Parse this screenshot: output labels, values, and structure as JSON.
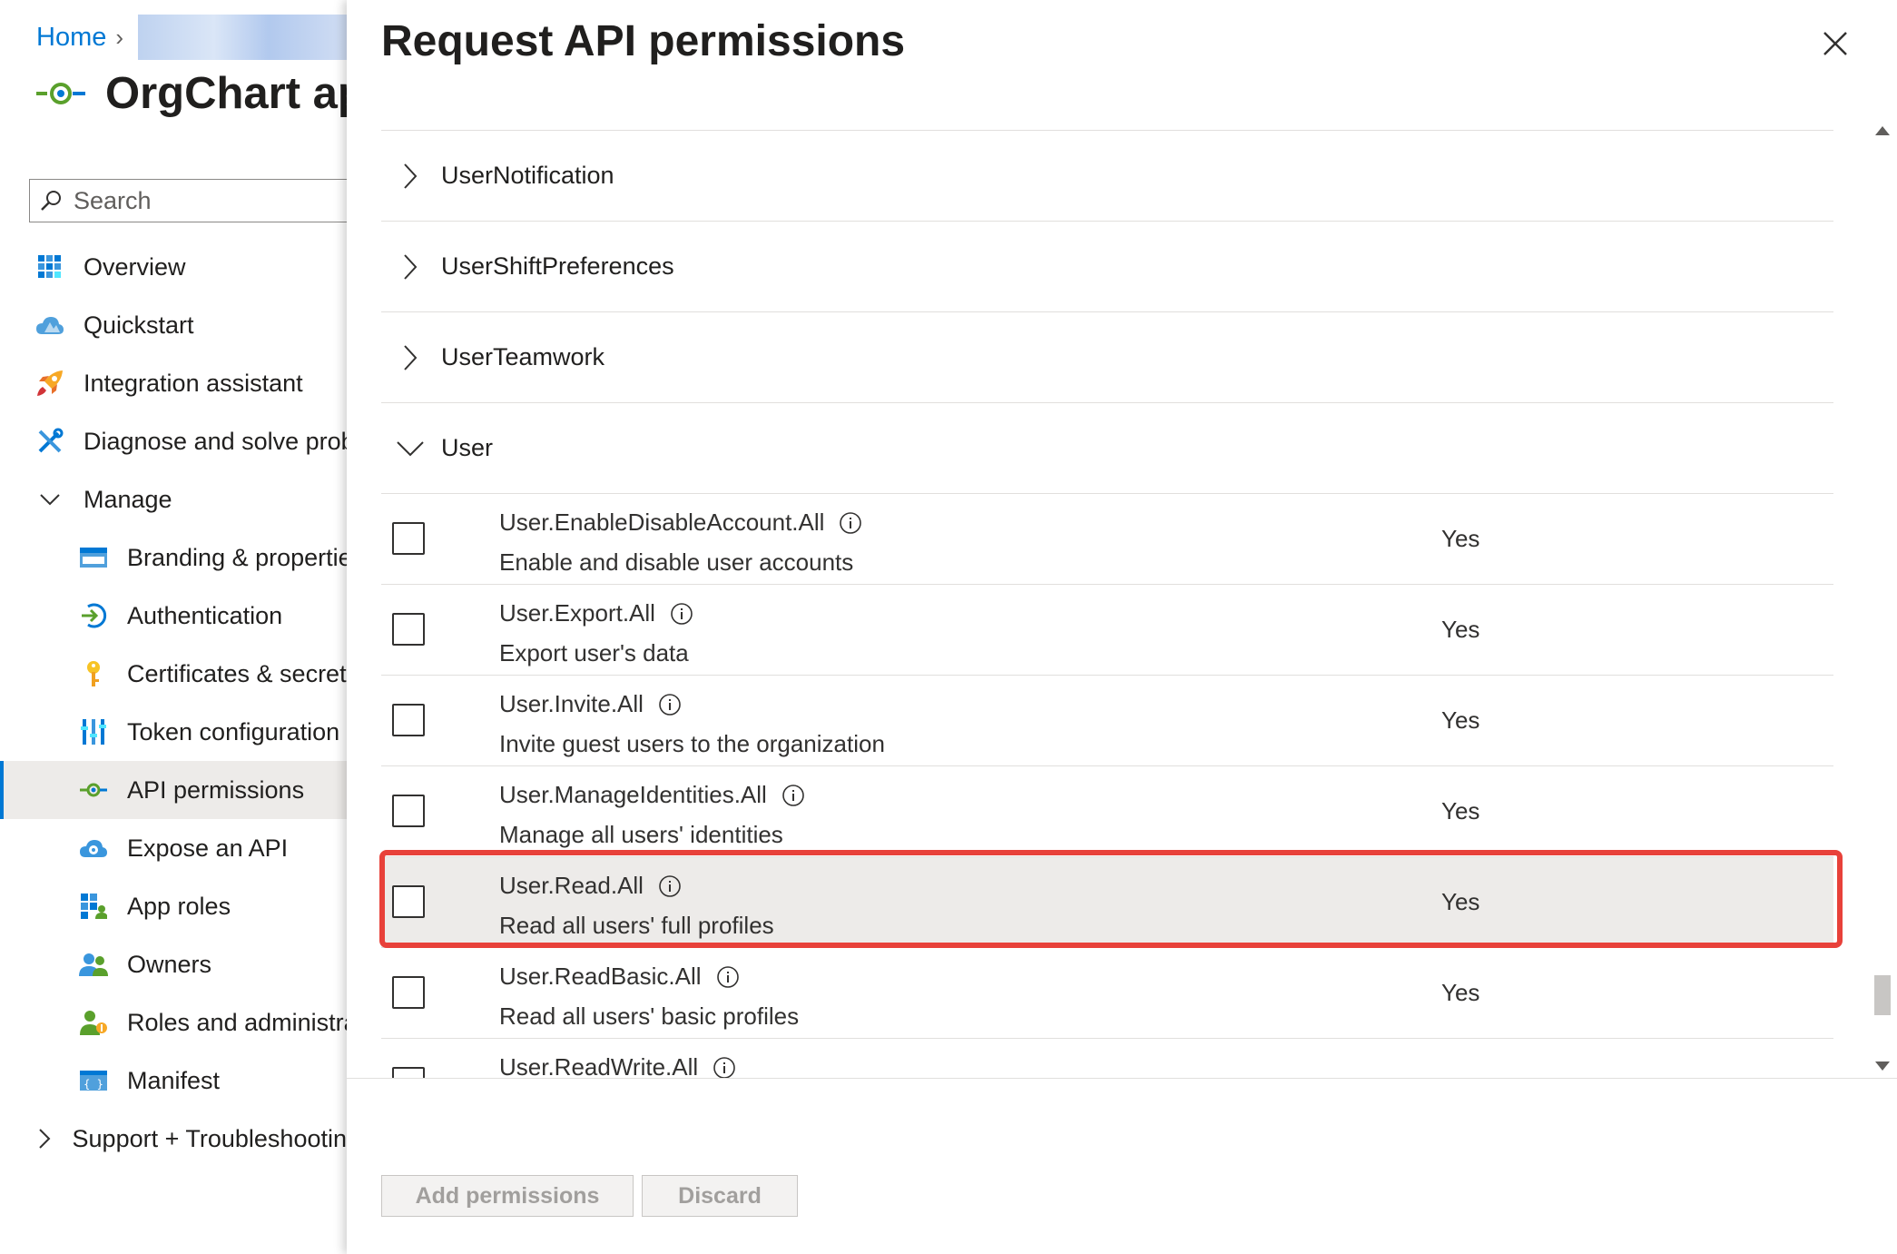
{
  "breadcrumb": {
    "home": "Home"
  },
  "app": {
    "title": "OrgChart ap"
  },
  "search": {
    "placeholder": "Search"
  },
  "nav": {
    "overview": "Overview",
    "quickstart": "Quickstart",
    "integration": "Integration assistant",
    "diagnose": "Diagnose and solve probl",
    "manage": "Manage",
    "branding": "Branding & propertie",
    "authentication": "Authentication",
    "certificates": "Certificates & secrets",
    "token": "Token configuration",
    "api_permissions": "API permissions",
    "expose_api": "Expose an API",
    "app_roles": "App roles",
    "owners": "Owners",
    "roles_admin": "Roles and administrat",
    "manifest": "Manifest",
    "support": "Support + Troubleshootin"
  },
  "panel": {
    "title": "Request API permissions",
    "groups": [
      {
        "label": "UserNotification"
      },
      {
        "label": "UserShiftPreferences"
      },
      {
        "label": "UserTeamwork"
      },
      {
        "label": "User"
      }
    ],
    "permissions": [
      {
        "name": "User.EnableDisableAccount.All",
        "description": "Enable and disable user accounts",
        "admin_consent": "Yes"
      },
      {
        "name": "User.Export.All",
        "description": "Export user's data",
        "admin_consent": "Yes"
      },
      {
        "name": "User.Invite.All",
        "description": "Invite guest users to the organization",
        "admin_consent": "Yes"
      },
      {
        "name": "User.ManageIdentities.All",
        "description": "Manage all users' identities",
        "admin_consent": "Yes"
      },
      {
        "name": "User.Read.All",
        "description": "Read all users' full profiles",
        "admin_consent": "Yes"
      },
      {
        "name": "User.ReadBasic.All",
        "description": "Read all users' basic profiles",
        "admin_consent": "Yes"
      },
      {
        "name": "User.ReadWrite.All",
        "description": "",
        "admin_consent": ""
      }
    ],
    "buttons": {
      "add": "Add permissions",
      "discard": "Discard"
    }
  },
  "colors": {
    "accent": "#0078d4",
    "highlight": "#e8413a",
    "selected_bg": "#edebe9"
  }
}
